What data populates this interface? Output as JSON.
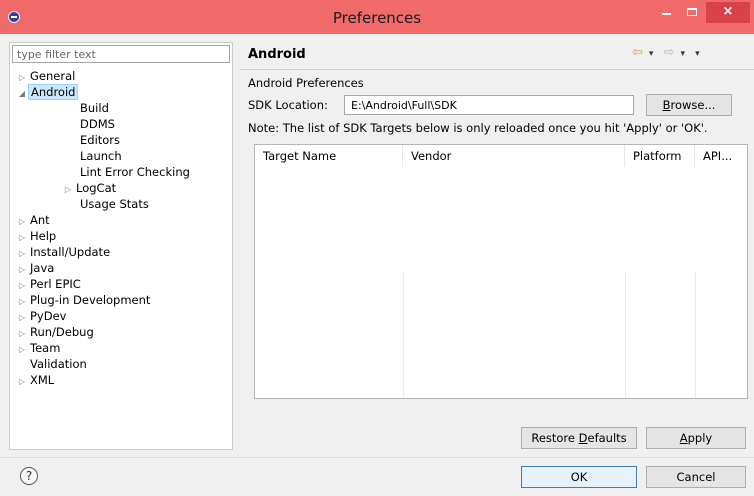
{
  "window": {
    "title": "Preferences",
    "close_glyph": "×"
  },
  "filter": {
    "placeholder": "type filter text"
  },
  "tree": [
    {
      "label": "General",
      "expandable": true,
      "level": 0
    },
    {
      "label": "Android",
      "expandable": true,
      "expanded": true,
      "selected": true,
      "level": 0
    },
    {
      "label": "Build",
      "level": 1
    },
    {
      "label": "DDMS",
      "level": 1
    },
    {
      "label": "Editors",
      "level": 1
    },
    {
      "label": "Launch",
      "level": 1
    },
    {
      "label": "Lint Error Checking",
      "level": 1
    },
    {
      "label": "LogCat",
      "expandable": true,
      "level": 1
    },
    {
      "label": "Usage Stats",
      "level": 1
    },
    {
      "label": "Ant",
      "expandable": true,
      "level": 0
    },
    {
      "label": "Help",
      "expandable": true,
      "level": 0
    },
    {
      "label": "Install/Update",
      "expandable": true,
      "level": 0
    },
    {
      "label": "Java",
      "expandable": true,
      "level": 0
    },
    {
      "label": "Perl EPIC",
      "expandable": true,
      "level": 0
    },
    {
      "label": "Plug-in Development",
      "expandable": true,
      "level": 0
    },
    {
      "label": "PyDev",
      "expandable": true,
      "level": 0
    },
    {
      "label": "Run/Debug",
      "expandable": true,
      "level": 0
    },
    {
      "label": "Team",
      "expandable": true,
      "level": 0
    },
    {
      "label": "Validation",
      "level": 0
    },
    {
      "label": "XML",
      "expandable": true,
      "level": 0
    }
  ],
  "page": {
    "title": "Android",
    "section_label": "Android Preferences",
    "sdk_label": "SDK Location:",
    "sdk_value": "E:\\Android\\Full\\SDK",
    "browse_label": "rowse...",
    "browse_mnemonic": "B",
    "note": "Note: The list of SDK Targets below is only reloaded once you hit 'Apply' or 'OK'."
  },
  "table": {
    "columns": [
      "Target Name",
      "Vendor",
      "Platform",
      "API..."
    ],
    "rows": []
  },
  "buttons": {
    "restore_prefix": "Restore ",
    "restore_mnemonic": "D",
    "restore_suffix": "efaults",
    "apply_mnemonic": "A",
    "apply_suffix": "pply",
    "ok": "OK",
    "cancel": "Cancel",
    "help": "?"
  },
  "nav": {
    "back": "⇦",
    "forward": "⇨",
    "menu": "▾"
  },
  "colors": {
    "titlebar": "#f06a6a",
    "selection": "#cce8ff"
  }
}
